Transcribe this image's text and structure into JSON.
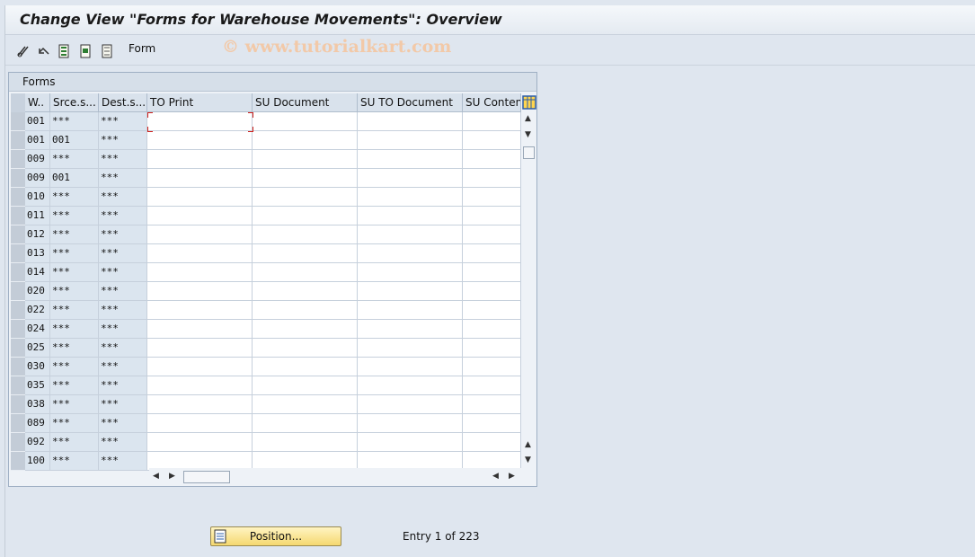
{
  "window": {
    "title": "Change View \"Forms for Warehouse Movements\": Overview",
    "watermark": "© www.tutorialkart.com"
  },
  "toolbar": {
    "icons": [
      "edit-glasses-icon",
      "undo-icon",
      "select-all-icon",
      "select-block-icon",
      "deselect-all-icon"
    ],
    "form_label": "Form"
  },
  "table": {
    "panel_title": "Forms",
    "columns": [
      "W..",
      "Srce.s...",
      "Dest.s...",
      "TO Print",
      "SU Document",
      "SU TO Document",
      "SU Content"
    ],
    "rows": [
      [
        "001",
        "***",
        "***"
      ],
      [
        "001",
        "001",
        "***"
      ],
      [
        "009",
        "***",
        "***"
      ],
      [
        "009",
        "001",
        "***"
      ],
      [
        "010",
        "***",
        "***"
      ],
      [
        "011",
        "***",
        "***"
      ],
      [
        "012",
        "***",
        "***"
      ],
      [
        "013",
        "***",
        "***"
      ],
      [
        "014",
        "***",
        "***"
      ],
      [
        "020",
        "***",
        "***"
      ],
      [
        "022",
        "***",
        "***"
      ],
      [
        "024",
        "***",
        "***"
      ],
      [
        "025",
        "***",
        "***"
      ],
      [
        "030",
        "***",
        "***"
      ],
      [
        "035",
        "***",
        "***"
      ],
      [
        "038",
        "***",
        "***"
      ],
      [
        "089",
        "***",
        "***"
      ],
      [
        "092",
        "***",
        "***"
      ],
      [
        "100",
        "***",
        "***"
      ]
    ]
  },
  "footer": {
    "position_button": "Position...",
    "entry_info": "Entry 1 of 223"
  },
  "colors": {
    "background": "#dfe6ef",
    "key_column": "#dbe5ef",
    "button_yellow": "#f5d870",
    "focus_red": "#d0201a"
  }
}
